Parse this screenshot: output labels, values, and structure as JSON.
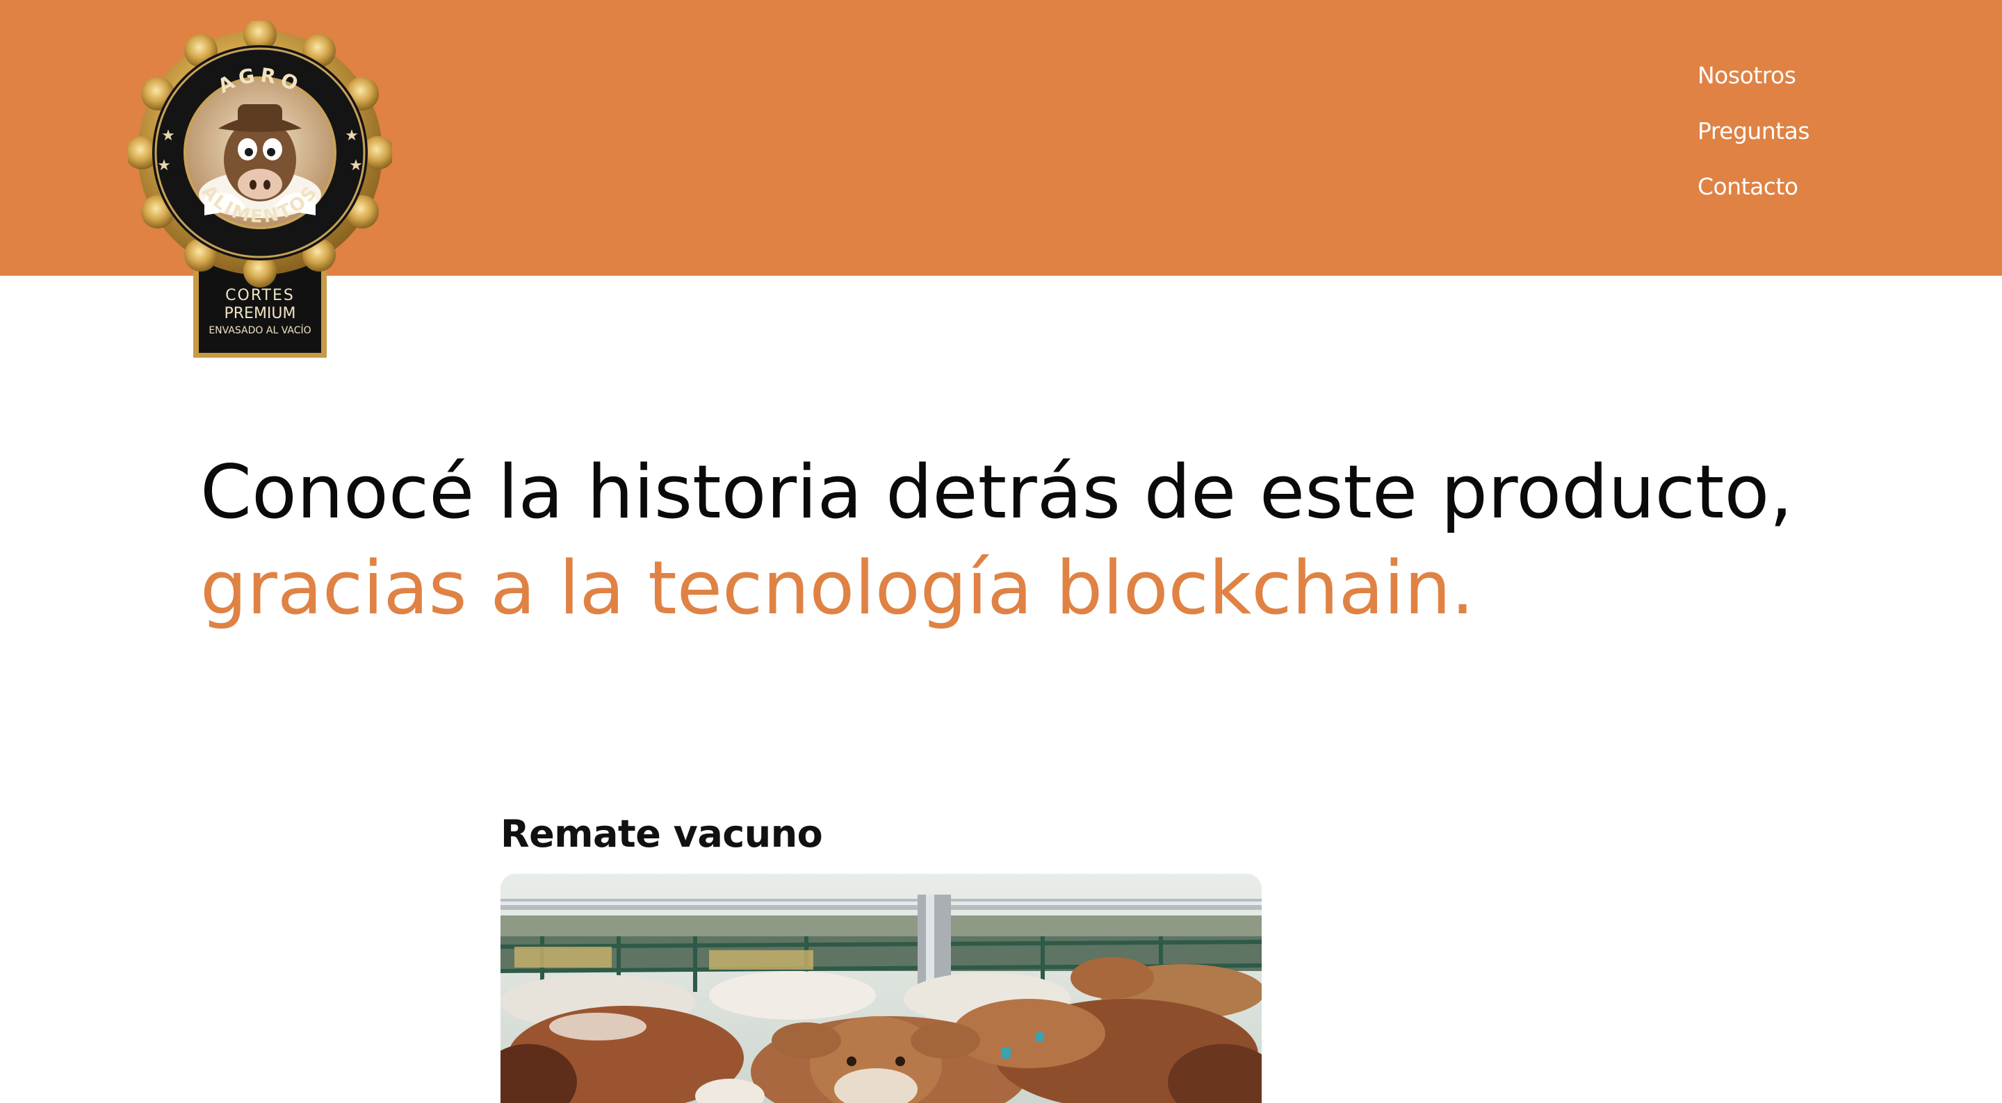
{
  "brand": {
    "logo_top": "AGRO",
    "logo_bottom": "ALIMENTOS",
    "ribbon_line1": "CORTES",
    "ribbon_line2": "PREMIUM",
    "ribbon_line3": "ENVASADO AL VACÍO"
  },
  "colors": {
    "accent": "#df8244",
    "text_dark": "#0a0a0a",
    "nav_text": "#ffffff"
  },
  "nav": {
    "items": [
      {
        "label": "Nosotros"
      },
      {
        "label": "Preguntas"
      },
      {
        "label": "Contacto"
      }
    ]
  },
  "hero": {
    "line1": "Conocé la historia detrás de este producto,",
    "line2": "gracias a la tecnología blockchain."
  },
  "card": {
    "title": "Remate vacuno",
    "image_icon": "cattle-photo"
  }
}
